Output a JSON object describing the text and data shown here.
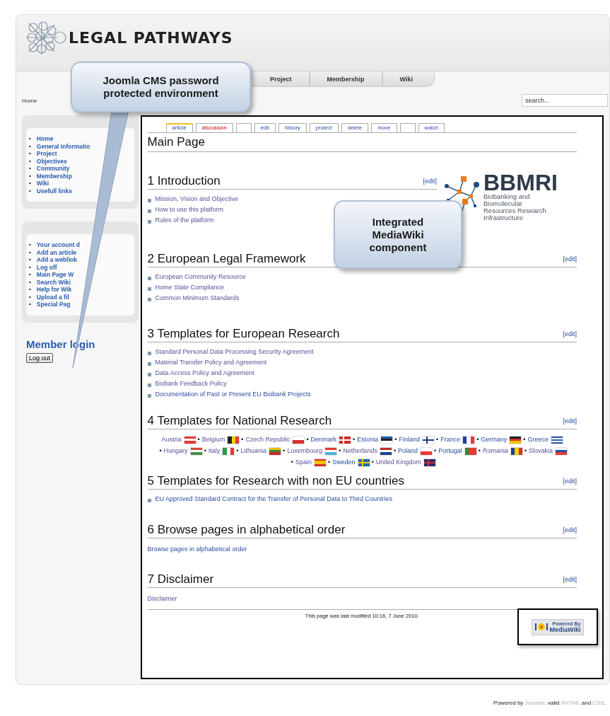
{
  "header": {
    "logo_text": "LEGAL PATHWAYS"
  },
  "nav_tabs": [
    {
      "label": "Project"
    },
    {
      "label": "Membership"
    },
    {
      "label": "Wiki"
    }
  ],
  "breadcrumb": "Home",
  "search": {
    "placeholder": "search..."
  },
  "sidebar": {
    "main_menu": [
      "Home",
      "General Informatio",
      "Project",
      "Objectives",
      "Community",
      "Membership",
      "Wiki",
      "Usefull links"
    ],
    "user_menu": [
      "Your account d",
      "Add an article",
      "Add a weblink",
      "Log off",
      "Main Page W",
      "Search Wiki",
      "Help for Wik",
      "Upload a fil",
      "Special Pag"
    ],
    "bullet": "•",
    "login_title": "Member login",
    "logout_button": "Log out"
  },
  "wiki": {
    "tabs": [
      {
        "label": "article",
        "selected": true,
        "missing": false,
        "gap_before": false
      },
      {
        "label": "discussion",
        "selected": false,
        "missing": true,
        "gap_before": false
      },
      {
        "label": "edit",
        "selected": false,
        "missing": false,
        "gap_before": true
      },
      {
        "label": "history",
        "selected": false,
        "missing": false,
        "gap_before": false
      },
      {
        "label": "protect",
        "selected": false,
        "missing": false,
        "gap_before": false
      },
      {
        "label": "delete",
        "selected": false,
        "missing": false,
        "gap_before": false
      },
      {
        "label": "move",
        "selected": false,
        "missing": false,
        "gap_before": false
      },
      {
        "label": "watch",
        "selected": false,
        "missing": false,
        "gap_before": true
      }
    ],
    "page_title": "Main Page",
    "logo": {
      "name": "BBMRI",
      "tagline": [
        "Biobanking and",
        "Biomolecular",
        "Resources Research",
        "Infrastructure"
      ]
    },
    "sections": [
      {
        "number": "1",
        "title": "Introduction",
        "edit": "[edit]",
        "kind": "links",
        "links": [
          {
            "text": "Mission, Vision and Objective",
            "visited": true
          },
          {
            "text": "How to use this platform",
            "visited": true
          },
          {
            "text": "Rules of the platform",
            "visited": true
          }
        ]
      },
      {
        "number": "2",
        "title": "European Legal Framework",
        "edit": "[edit]",
        "kind": "links",
        "links": [
          {
            "text": "European Community Resource",
            "visited": true
          },
          {
            "text": "Home State Compliance",
            "visited": true
          },
          {
            "text": "Common Minimum Standards",
            "visited": true
          }
        ]
      },
      {
        "number": "3",
        "title": "Templates for European Research",
        "edit": "[edit]",
        "kind": "links",
        "links": [
          {
            "text": "Standard Personal Data Processing Security Agreement",
            "visited": true
          },
          {
            "text": "Material Transfer Policy and Agreement",
            "visited": true
          },
          {
            "text": "Data Access Policy and Agreement",
            "visited": true
          },
          {
            "text": "Biobank Feedback Policy",
            "visited": true
          },
          {
            "text": "Documentation of Past or Present EU Biobank Projects",
            "visited": false
          }
        ]
      },
      {
        "number": "4",
        "title": "Templates for National Research",
        "edit": "[edit]",
        "kind": "countries",
        "separator": "•",
        "countries": [
          {
            "name": "Austria",
            "visited": true,
            "flag": {
              "kind": "h",
              "stripes": [
                {
                  "color": "#e53935"
                },
                {
                  "color": "#ffffff"
                },
                {
                  "color": "#e53935"
                }
              ]
            }
          },
          {
            "name": "Belgium",
            "visited": true,
            "flag": {
              "kind": "v",
              "stripes": [
                {
                  "color": "#222222"
                },
                {
                  "color": "#f5d000"
                },
                {
                  "color": "#e53935"
                }
              ]
            }
          },
          {
            "name": "Czech Republic",
            "visited": true,
            "flag": {
              "kind": "h",
              "stripes": [
                {
                  "color": "#ffffff"
                },
                {
                  "color": "#d32f2f"
                }
              ]
            }
          },
          {
            "name": "Denmark",
            "visited": false,
            "flag": {
              "kind": "cross",
              "stripes": [
                {
                  "color": "#d32f2f"
                },
                {
                  "color": "#ffffff"
                }
              ]
            }
          },
          {
            "name": "Estonia",
            "visited": false,
            "flag": {
              "kind": "h",
              "stripes": [
                {
                  "color": "#1f5fb0"
                },
                {
                  "color": "#222222"
                },
                {
                  "color": "#ffffff"
                }
              ]
            }
          },
          {
            "name": "Finland",
            "visited": false,
            "flag": {
              "kind": "cross",
              "stripes": [
                {
                  "color": "#ffffff"
                },
                {
                  "color": "#1a3f8f"
                }
              ]
            }
          },
          {
            "name": "France",
            "visited": false,
            "flag": {
              "kind": "v",
              "stripes": [
                {
                  "color": "#1f3fa0"
                },
                {
                  "color": "#ffffff"
                },
                {
                  "color": "#e53935"
                }
              ]
            }
          },
          {
            "name": "Germany",
            "visited": false,
            "flag": {
              "kind": "h",
              "stripes": [
                {
                  "color": "#222222"
                },
                {
                  "color": "#d32f2f"
                },
                {
                  "color": "#f5c000"
                }
              ]
            }
          },
          {
            "name": "Greece",
            "visited": false,
            "flag": {
              "kind": "h",
              "stripes": [
                {
                  "color": "#2a5bb8"
                },
                {
                  "color": "#ffffff"
                },
                {
                  "color": "#2a5bb8"
                },
                {
                  "color": "#ffffff"
                },
                {
                  "color": "#2a5bb8"
                }
              ]
            }
          },
          {
            "name": "Hungary",
            "visited": true,
            "flag": {
              "kind": "h",
              "stripes": [
                {
                  "color": "#d84a3a"
                },
                {
                  "color": "#ffffff"
                },
                {
                  "color": "#4a8a4a"
                }
              ]
            }
          },
          {
            "name": "Italy",
            "visited": true,
            "flag": {
              "kind": "v",
              "stripes": [
                {
                  "color": "#2e9a4a"
                },
                {
                  "color": "#ffffff"
                },
                {
                  "color": "#e53935"
                }
              ]
            }
          },
          {
            "name": "Lithuania",
            "visited": true,
            "flag": {
              "kind": "h",
              "stripes": [
                {
                  "color": "#f5c000"
                },
                {
                  "color": "#3a8a3a"
                },
                {
                  "color": "#c62828"
                }
              ]
            }
          },
          {
            "name": "Luxembourg",
            "visited": true,
            "flag": {
              "kind": "h",
              "stripes": [
                {
                  "color": "#e53935"
                },
                {
                  "color": "#ffffff"
                },
                {
                  "color": "#4fb0e0"
                }
              ]
            }
          },
          {
            "name": "Netherlands",
            "visited": true,
            "flag": {
              "kind": "h",
              "stripes": [
                {
                  "color": "#c62828"
                },
                {
                  "color": "#ffffff"
                },
                {
                  "color": "#1f3f90"
                }
              ]
            }
          },
          {
            "name": "Poland",
            "visited": false,
            "flag": {
              "kind": "h",
              "stripes": [
                {
                  "color": "#ffffff"
                },
                {
                  "color": "#e53935"
                }
              ]
            }
          },
          {
            "name": "Portugal",
            "visited": false,
            "flag": {
              "kind": "v",
              "stripes": [
                {
                  "color": "#2e8a3a"
                },
                {
                  "color": "#e53935"
                },
                {
                  "color": "#e53935"
                }
              ]
            }
          },
          {
            "name": "Romania",
            "visited": true,
            "flag": {
              "kind": "v",
              "stripes": [
                {
                  "color": "#1f3fa0"
                },
                {
                  "color": "#f5d000"
                },
                {
                  "color": "#d32f2f"
                }
              ]
            }
          },
          {
            "name": "Slovakia",
            "visited": true,
            "flag": {
              "kind": "h",
              "stripes": [
                {
                  "color": "#ffffff"
                },
                {
                  "color": "#1f4fb0"
                },
                {
                  "color": "#e53935"
                }
              ]
            }
          },
          {
            "name": "Spain",
            "visited": true,
            "flag": {
              "kind": "h",
              "stripes": [
                {
                  "color": "#d32f2f"
                },
                {
                  "color": "#f5c000"
                },
                {
                  "color": "#f5c000"
                },
                {
                  "color": "#d32f2f"
                }
              ]
            }
          },
          {
            "name": "Sweden",
            "visited": false,
            "flag": {
              "kind": "cross",
              "stripes": [
                {
                  "color": "#2a63b0"
                },
                {
                  "color": "#f5c800"
                }
              ]
            }
          },
          {
            "name": "United Kingdom",
            "visited": true,
            "flag": {
              "kind": "cross",
              "stripes": [
                {
                  "color": "#1f3070"
                },
                {
                  "color": "#d32f2f"
                }
              ]
            }
          }
        ]
      },
      {
        "number": "5",
        "title": "Templates for Research with non EU countries",
        "edit": "[edit]",
        "kind": "links",
        "links": [
          {
            "text": "EU Approved Standard Contract for the Transfer of Personal Data to Third Countries",
            "visited": false
          }
        ]
      },
      {
        "number": "6",
        "title": "Browse pages in alphabetical order",
        "edit": "[edit]",
        "kind": "plain",
        "links": [
          {
            "text": "Browse pages in alphabetical order",
            "visited": false
          }
        ]
      },
      {
        "number": "7",
        "title": "Disclaimer",
        "edit": "[edit]",
        "kind": "plain",
        "links": [
          {
            "text": "Disclaimer",
            "visited": true
          }
        ]
      }
    ],
    "footer": "This page was last modified 10:16, 7 June 2010.",
    "badge": {
      "line1": "Powered By",
      "line2": "MediaWiki"
    }
  },
  "callouts": [
    {
      "text": "Joomla CMS password protected environment",
      "kind": "pointer"
    },
    {
      "text": "Integrated MediaWiki component",
      "kind": "plain"
    }
  ],
  "footer": {
    "parts": [
      {
        "text": "Powered by ",
        "kind": "text"
      },
      {
        "text": "Joomla!",
        "kind": "link"
      },
      {
        "text": ". valid ",
        "kind": "text"
      },
      {
        "text": "XHTML",
        "kind": "link"
      },
      {
        "text": " and ",
        "kind": "text"
      },
      {
        "text": "CSS",
        "kind": "link"
      },
      {
        "text": ".",
        "kind": "text"
      }
    ]
  }
}
